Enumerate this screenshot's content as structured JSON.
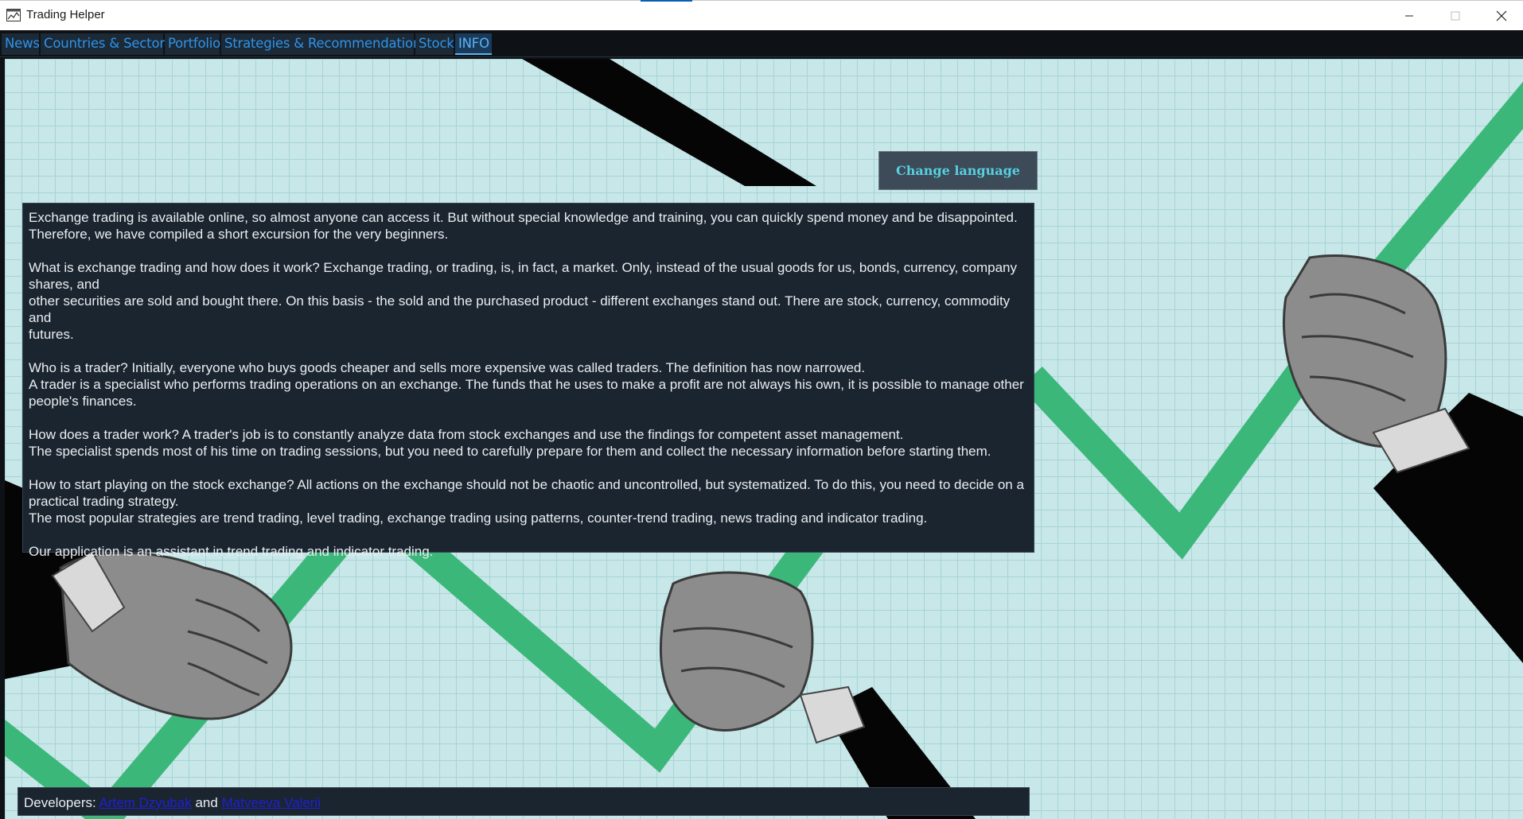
{
  "window": {
    "title": "Trading Helper",
    "icon": "app-chart-icon",
    "controls": [
      "minimize-icon",
      "maximize-icon",
      "close-icon"
    ]
  },
  "tabs": [
    {
      "label": "News"
    },
    {
      "label": "Countries & Sectors"
    },
    {
      "label": "Portfolio"
    },
    {
      "label": "Strategies & Recommendations"
    },
    {
      "label": "Stock"
    },
    {
      "label": "INFO",
      "active": true
    }
  ],
  "info": {
    "change_language_label": "Change language",
    "paragraphs": [
      [
        "Exchange trading is available online, so almost anyone can access it. But without special knowledge and training, you can quickly spend money and be disappointed.",
        "Therefore, we have compiled a short excursion for the very beginners."
      ],
      [
        "What is exchange trading and how does it work? Exchange trading, or trading, is, in fact, a market. Only, instead of the usual goods for us, bonds, currency, company",
        "shares, and",
        "other securities are sold and bought there. On this basis - the sold and the purchased product - different exchanges stand out. There are stock, currency, commodity and",
        "futures."
      ],
      [
        "Who is a trader? Initially, everyone who buys goods cheaper and sells more expensive was called traders. The definition has now narrowed.",
        "A trader is a specialist who performs trading operations on an exchange. The funds that he uses to make a profit are not always his own, it is possible to manage other",
        "people's finances."
      ],
      [
        "How does a trader work? A trader's job is to constantly analyze data from stock exchanges and use the findings for competent asset management.",
        "The specialist spends most of his time on trading sessions, but you need to carefully prepare for them and collect the necessary information before starting them."
      ],
      [
        "How to start playing on the stock exchange? All actions on the exchange should not be chaotic and uncontrolled, but systematized. To do this, you need to decide on a",
        "practical trading strategy.",
        "The most popular strategies are trend trading, level trading, exchange trading using patterns, counter-trend trading, news trading and indicator trading."
      ],
      [
        "Our application is an assistant in trend trading and indicator trading."
      ]
    ]
  },
  "footer": {
    "prefix": "Developers:",
    "developer_1": "Artem Dzyubak",
    "joiner": "and",
    "developer_2": "Matveeva Valerii"
  },
  "colors": {
    "tab_text": "#2f93e8",
    "chart_line": "#3bb77a",
    "background_grid": "#c7e7e8",
    "panel": "#1b2530"
  }
}
